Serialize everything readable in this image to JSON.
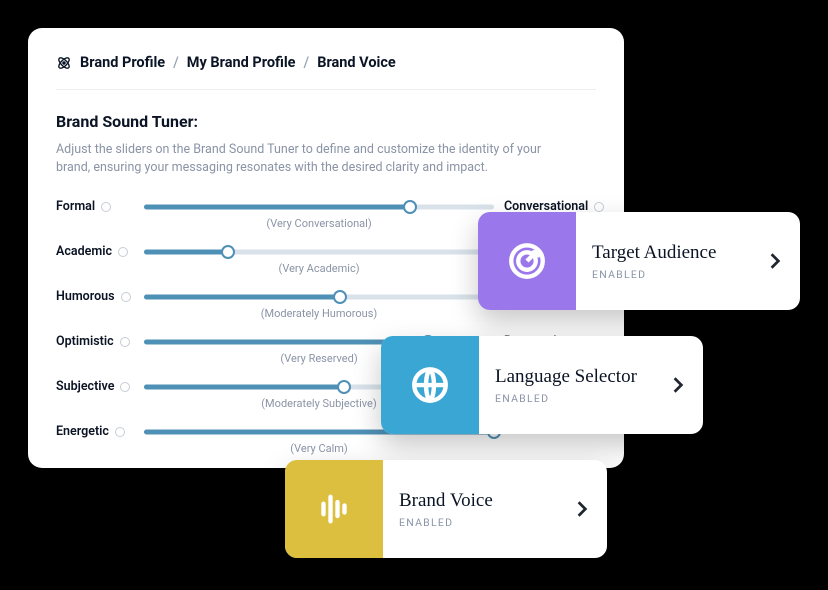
{
  "colors": {
    "accent_slider": "#4f90b6",
    "card_purple": "#9a77ea",
    "card_blue": "#3aa6d3",
    "card_yellow": "#dcbf3f"
  },
  "breadcrumb": {
    "root": "Brand Profile",
    "mid": "My Brand Profile",
    "leaf": "Brand Voice"
  },
  "section": {
    "title": "Brand Sound Tuner:",
    "desc": "Adjust the sliders on the Brand Sound Tuner to define and customize the identity of your brand, ensuring your messaging resonates with the desired clarity and impact."
  },
  "sliders": [
    {
      "left": "Formal",
      "right": "Conversational",
      "percent": 76,
      "caption": "(Very Conversational)"
    },
    {
      "left": "Academic",
      "right": "",
      "percent": 24,
      "caption": "(Very Academic)"
    },
    {
      "left": "Humorous",
      "right": "",
      "percent": 56,
      "caption": "(Moderately Humorous)"
    },
    {
      "left": "Optimistic",
      "right": "Reserved",
      "percent": 81,
      "caption": "(Very Reserved)"
    },
    {
      "left": "Subjective",
      "right": "",
      "percent": 57,
      "caption": "(Moderately Subjective)"
    },
    {
      "left": "Energetic",
      "right": "",
      "percent": 100,
      "caption": "(Very Calm)"
    }
  ],
  "cards": [
    {
      "icon": "target-icon",
      "title": "Target Audience",
      "status": "ENABLED"
    },
    {
      "icon": "globe-icon",
      "title": "Language Selector",
      "status": "ENABLED"
    },
    {
      "icon": "wave-icon",
      "title": "Brand Voice",
      "status": "ENABLED"
    }
  ]
}
